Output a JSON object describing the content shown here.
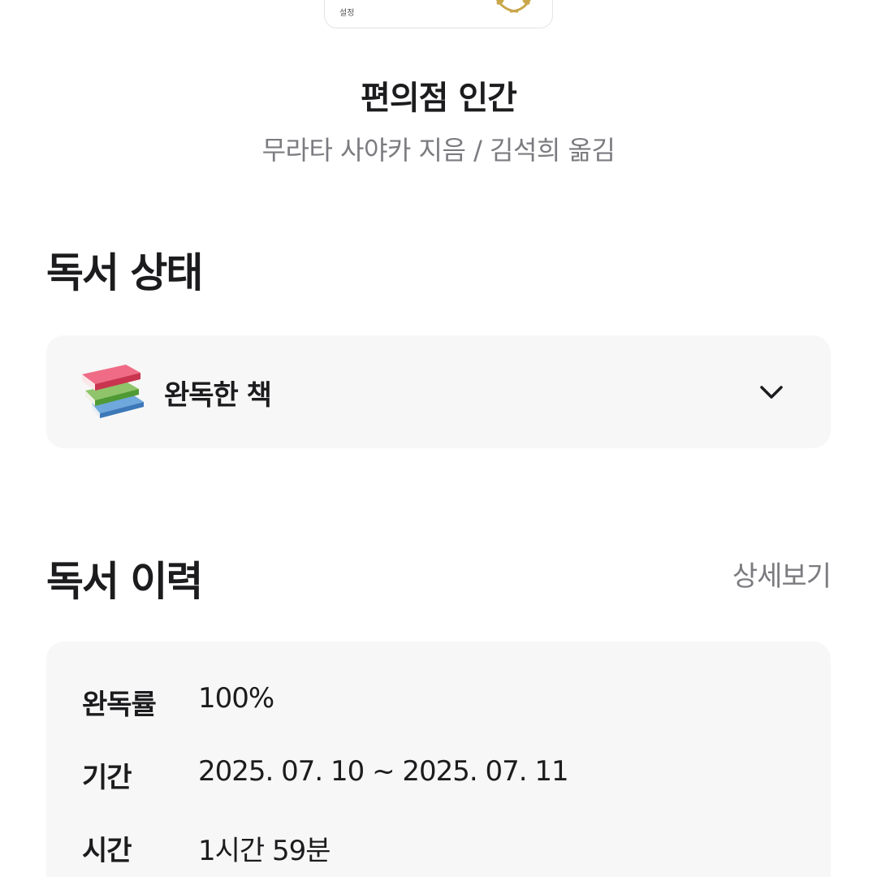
{
  "book": {
    "cover_text": "설정",
    "title": "편의점 인간",
    "author_line": "무라타 사야카 지음 / 김석희 옮김"
  },
  "status_section": {
    "title": "독서 상태",
    "selected": "완독한 책",
    "icon": "books-stack-icon"
  },
  "history_section": {
    "title": "독서 이력",
    "detail_link": "상세보기",
    "rows": [
      {
        "label": "완독률",
        "value": "100%"
      },
      {
        "label": "기간",
        "value": "2025. 07. 10 ~ 2025. 07. 11"
      },
      {
        "label": "시간",
        "value": "1시간 59분"
      }
    ]
  },
  "colors": {
    "text_primary": "#1c1c1e",
    "text_secondary": "#7b7b80",
    "card_background": "#f7f7f7"
  }
}
